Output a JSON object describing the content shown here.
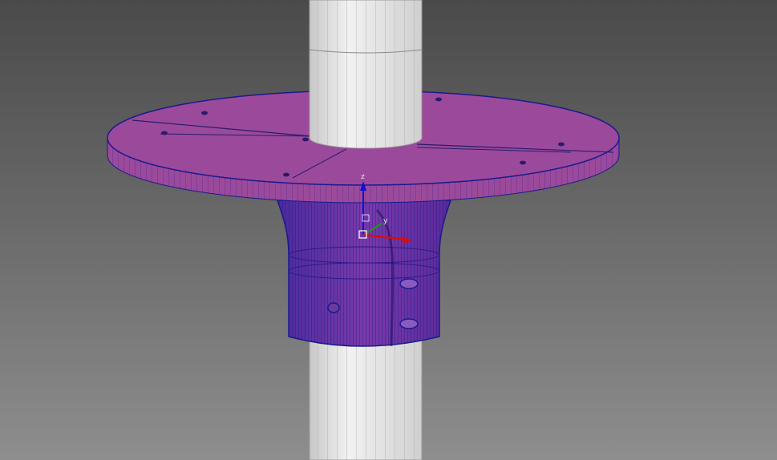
{
  "viewport": {
    "background_top": "#4a4a4a",
    "background_bottom": "#8e8e8e"
  },
  "colors": {
    "part_face": "#9b4a9b",
    "part_edge": "#1a1a8c",
    "shaft_face": "#d9d9d9",
    "shaft_edge": "#9a9a9a",
    "axis_x": "#d01010",
    "axis_y": "#10a010",
    "axis_z": "#1010d0"
  },
  "triad": {
    "z_label": "z",
    "y_label": "y"
  }
}
